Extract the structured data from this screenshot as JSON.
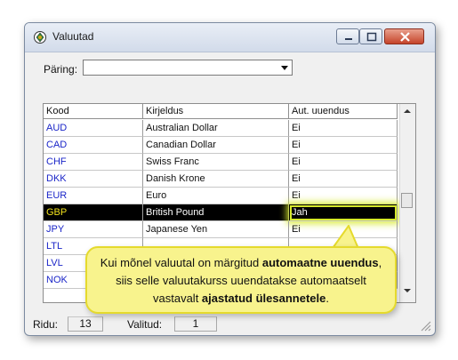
{
  "window": {
    "title": "Valuutad"
  },
  "query": {
    "label": "Päring:",
    "value": ""
  },
  "grid": {
    "headers": [
      "Kood",
      "Kirjeldus",
      "Aut. uuendus"
    ],
    "rows": [
      {
        "code": "AUD",
        "desc": "Australian Dollar",
        "auto": "Ei"
      },
      {
        "code": "CAD",
        "desc": "Canadian Dollar",
        "auto": "Ei"
      },
      {
        "code": "CHF",
        "desc": "Swiss Franc",
        "auto": "Ei"
      },
      {
        "code": "DKK",
        "desc": "Danish Krone",
        "auto": "Ei"
      },
      {
        "code": "EUR",
        "desc": "Euro",
        "auto": "Ei"
      },
      {
        "code": "GBP",
        "desc": "British Pound",
        "auto": "Jah"
      },
      {
        "code": "JPY",
        "desc": "Japanese Yen",
        "auto": "Ei"
      },
      {
        "code": "LTL",
        "desc": "",
        "auto": ""
      },
      {
        "code": "LVL",
        "desc": "",
        "auto": ""
      },
      {
        "code": "NOK",
        "desc": "",
        "auto": ""
      }
    ]
  },
  "status": {
    "rows_label": "Ridu:",
    "rows_value": "13",
    "selected_label": "Valitud:",
    "selected_value": "1"
  },
  "callout": {
    "t1": "Kui mõnel valuutal on märgitud ",
    "b1": "automaatne uuendus",
    "t2": ", siis selle valuutakurss uuendatakse automaatselt vastavalt ",
    "b2": "ajastatud ülesannetele",
    "t3": "."
  },
  "colors": {
    "accent_yellow": "#f8f38d",
    "highlight": "#d7ea2b",
    "code_blue": "#1a25c8"
  }
}
